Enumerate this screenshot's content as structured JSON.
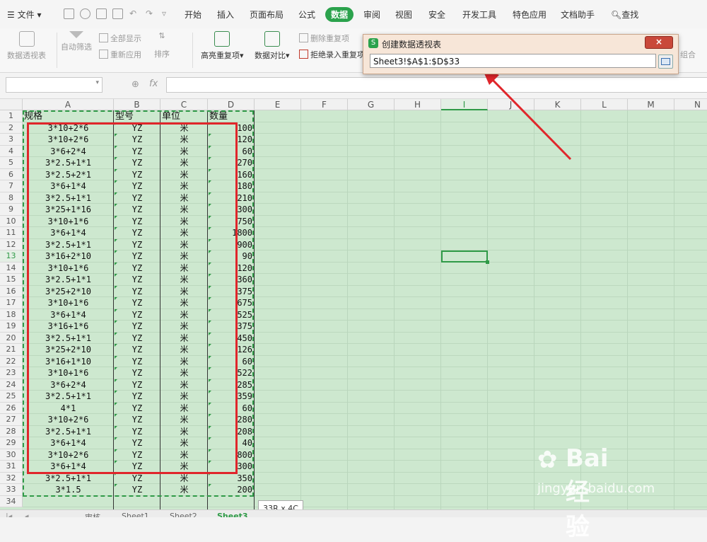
{
  "menu": {
    "file": "文件",
    "items": [
      "开始",
      "插入",
      "页面布局",
      "公式",
      "数据",
      "审阅",
      "视图",
      "安全",
      "开发工具",
      "特色应用",
      "文档助手"
    ],
    "active": "数据",
    "search": "查找"
  },
  "ribbon": {
    "pivot": "数据透视表",
    "autofilter": "自动筛选",
    "show_all": "全部显示",
    "reapply": "重新应用",
    "sort": "排序",
    "highlight_dup": "高亮重复项",
    "compare": "数据对比",
    "remove_dup": "删除重复项",
    "reject_dup": "拒绝录入重复项",
    "group": "组合"
  },
  "formula": {
    "fx": "fx"
  },
  "columns": [
    "A",
    "B",
    "C",
    "D",
    "E",
    "F",
    "G",
    "H",
    "I",
    "J",
    "K",
    "L",
    "M",
    "N"
  ],
  "selected_column": "I",
  "selected_row": "13",
  "rows": [
    "1",
    "2",
    "3",
    "4",
    "5",
    "6",
    "7",
    "8",
    "9",
    "10",
    "11",
    "12",
    "13",
    "14",
    "15",
    "16",
    "17",
    "18",
    "19",
    "20",
    "21",
    "22",
    "23",
    "24",
    "25",
    "26",
    "27",
    "28",
    "29",
    "30",
    "31",
    "32",
    "33",
    "34"
  ],
  "table": {
    "headers": [
      "规格",
      "型号",
      "单位",
      "数量"
    ],
    "data": [
      [
        "3*10+2*6",
        "YZ",
        "米",
        "100"
      ],
      [
        "3*10+2*6",
        "YZ",
        "米",
        "120"
      ],
      [
        "3*6+2*4",
        "YZ",
        "米",
        "60"
      ],
      [
        "3*2.5+1*1",
        "YZ",
        "米",
        "270"
      ],
      [
        "3*2.5+2*1",
        "YZ",
        "米",
        "160"
      ],
      [
        "3*6+1*4",
        "YZ",
        "米",
        "180"
      ],
      [
        "3*2.5+1*1",
        "YZ",
        "米",
        "210"
      ],
      [
        "3*25+1*16",
        "YZ",
        "米",
        "300"
      ],
      [
        "3*10+1*6",
        "YZ",
        "米",
        "750"
      ],
      [
        "3*6+1*4",
        "YZ",
        "米",
        "1800"
      ],
      [
        "3*2.5+1*1",
        "YZ",
        "米",
        "900"
      ],
      [
        "3*16+2*10",
        "YZ",
        "米",
        "90"
      ],
      [
        "3*10+1*6",
        "YZ",
        "米",
        "120"
      ],
      [
        "3*2.5+1*1",
        "YZ",
        "米",
        "360"
      ],
      [
        "3*25+2*10",
        "YZ",
        "米",
        "375"
      ],
      [
        "3*10+1*6",
        "YZ",
        "米",
        "675"
      ],
      [
        "3*6+1*4",
        "YZ",
        "米",
        "525"
      ],
      [
        "3*16+1*6",
        "YZ",
        "米",
        "375"
      ],
      [
        "3*2.5+1*1",
        "YZ",
        "米",
        "450"
      ],
      [
        "3*25+2*10",
        "YZ",
        "米",
        "126"
      ],
      [
        "3*16+1*10",
        "YZ",
        "米",
        "60"
      ],
      [
        "3*10+1*6",
        "YZ",
        "米",
        "522"
      ],
      [
        "3*6+2*4",
        "YZ",
        "米",
        "285"
      ],
      [
        "3*2.5+1*1",
        "YZ",
        "米",
        "359"
      ],
      [
        "4*1",
        "YZ",
        "米",
        "60"
      ],
      [
        "3*10+2*6",
        "YZ",
        "米",
        "280"
      ],
      [
        "3*2.5+1*1",
        "YZ",
        "米",
        "208"
      ],
      [
        "3*6+1*4",
        "YZ",
        "米",
        "40"
      ],
      [
        "3*10+2*6",
        "YZ",
        "米",
        "800"
      ],
      [
        "3*6+1*4",
        "YZ",
        "米",
        "300"
      ],
      [
        "3*2.5+1*1",
        "YZ",
        "米",
        "350"
      ],
      [
        "3*1.5",
        "YZ",
        "米",
        "200"
      ]
    ]
  },
  "dialog": {
    "title": "创建数据透视表",
    "close": "×",
    "range": "Sheet3!$A$1:$D$33"
  },
  "sheet_tabs": [
    "审核",
    "Sheet1",
    "Sheet2",
    "Sheet3"
  ],
  "active_sheet": "Sheet3",
  "dim_tip": "33R x 4C",
  "watermark": {
    "brand": "Bai经验",
    "url": "jingyan.baidu.com"
  },
  "colors": {
    "accent": "#2ba24c",
    "sheet_bg": "#cde8cf",
    "annotation": "#e0262b"
  }
}
